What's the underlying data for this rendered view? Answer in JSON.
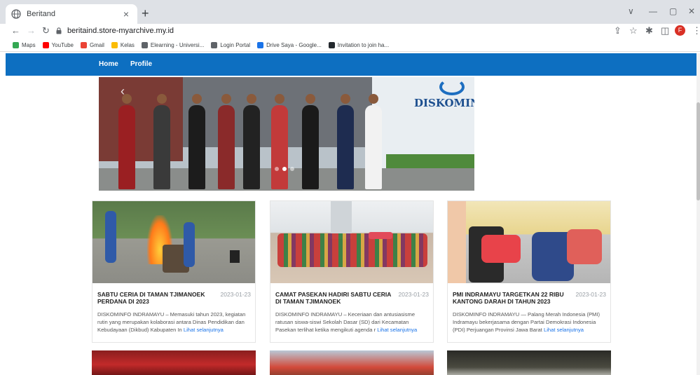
{
  "browser": {
    "tab_title": "Beritand",
    "tab_close": "×",
    "new_tab": "+",
    "url": "beritaind.store-myarchive.my.id",
    "window_minimize": "∨",
    "window_min2": "—",
    "window_restore": "▢",
    "window_close": "✕",
    "profile_initial": "F",
    "bookmarks": [
      {
        "label": "Maps",
        "color": "#34a853"
      },
      {
        "label": "YouTube",
        "color": "#ff0000"
      },
      {
        "label": "Gmail",
        "color": "#ea4335"
      },
      {
        "label": "Kelas",
        "color": "#fbbc04"
      },
      {
        "label": "Elearning - Universi...",
        "color": "#5f6368"
      },
      {
        "label": "Login Portal",
        "color": "#5f6368"
      },
      {
        "label": "Drive Saya - Google...",
        "color": "#1a73e8"
      },
      {
        "label": "Invitation to join ha...",
        "color": "#24292e"
      }
    ]
  },
  "site": {
    "nav": {
      "home": "Home",
      "profile": "Profile"
    },
    "brand_color": "#0d6fc1",
    "hero_logo_text": "DISKOMINF",
    "carousel_prev": "‹"
  },
  "cards": [
    {
      "title": "SABTU CERIA DI TAMAN TJIMANOEK PERDANA DI 2023",
      "date": "2023-01-23",
      "excerpt": "DISKOMINFO INDRAMAYU – Memasuki tahun 2023, kegiatan rutin yang merupakan kolaborasi antara Dinas Pendidikan dan Kebudayaan (Dikbud) Kabupaten In",
      "more": "Lihat selanjutnya"
    },
    {
      "title": "CAMAT PASEKAN HADIRI SABTU CERIA DI TAMAN TJIMANOEK",
      "date": "2023-01-23",
      "excerpt": "DISKOMINFO INDRAMAYU – Keceriaan dan antusiasisme ratusan siswa-siswi Sekolah Dasar (SD) dari Kecamatan Pasekan terlihat ketika mengikuti agenda r",
      "more": "Lihat selanjutnya"
    },
    {
      "title": "PMI INDRAMAYU TARGETKAN 22 RIBU KANTONG DARAH DI TAHUN 2023",
      "date": "2023-01-23",
      "excerpt": "DISKOMINFO INDRAMAYU — Palang Merah Indonesia (PMI) Indramayu bekerjasama dengan Partai Demokrasi Indonesia (PDI) Perjuangan Provinsi Jawa Barat",
      "more": "Lihat selanjutnya"
    }
  ]
}
